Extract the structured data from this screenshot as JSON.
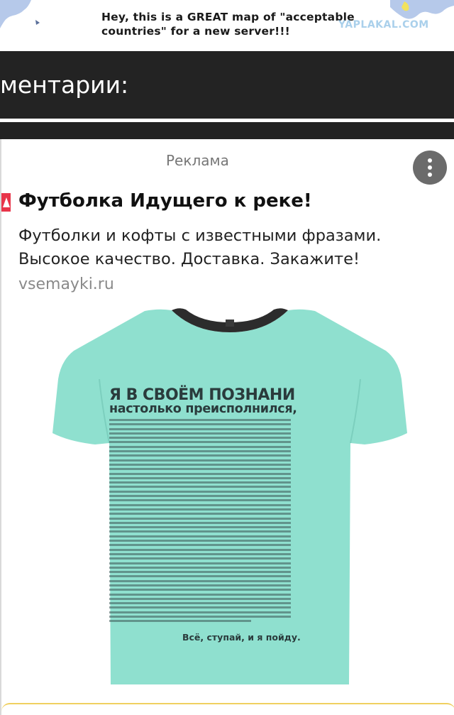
{
  "banner": {
    "caption_line1": "Hey, this is a GREAT map of \"acceptable",
    "caption_line2": "countries\" for a new server!!!",
    "watermark": "YAPLAKAL.COM"
  },
  "comments_header": {
    "title": "ментарии:"
  },
  "ad": {
    "label": "Реклама",
    "menu_icon": "more-vertical-icon",
    "mark_icon": "ad-marker-icon",
    "title": "Футболка Идущего к реке!",
    "description_line1": "Футболки и кофты с известными фразами.",
    "description_line2": "Высокое качество. Доставка. Закажите!",
    "domain": "vsemayki.ru",
    "product": {
      "shirt_color": "#8fe0cf",
      "print_heading": "Я В СВОЁМ ПОЗНАНИ",
      "print_subheading": "настолько преисполнился,",
      "print_signoff": "Всё, ступай, и я пойду."
    }
  },
  "colors": {
    "dark_bar": "#232323",
    "ad_accent": "#e8354a",
    "menu_button": "#6b6b6b"
  }
}
